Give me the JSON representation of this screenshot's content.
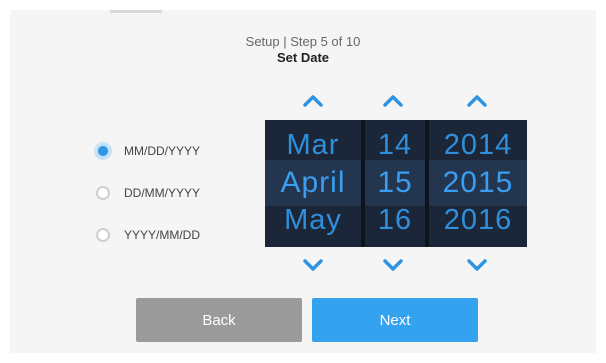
{
  "header": {
    "step_text": "Setup | Step 5 of 10",
    "title": "Set Date"
  },
  "formats": [
    {
      "label": "MM/DD/YYYY",
      "selected": true
    },
    {
      "label": "DD/MM/YYYY",
      "selected": false
    },
    {
      "label": "YYYY/MM/DD",
      "selected": false
    }
  ],
  "picker": {
    "month": {
      "prev": "Mar",
      "current": "April",
      "next": "May"
    },
    "day": {
      "prev": "14",
      "current": "15",
      "next": "16"
    },
    "year": {
      "prev": "2014",
      "current": "2015",
      "next": "2016"
    }
  },
  "icons": {
    "up": "chevron-up-icon",
    "down": "chevron-down-icon"
  },
  "buttons": {
    "back": "Back",
    "next": "Next"
  },
  "colors": {
    "accent": "#33a3f0",
    "picker_bg": "#1a2433",
    "back_button": "#9a9a9a"
  }
}
